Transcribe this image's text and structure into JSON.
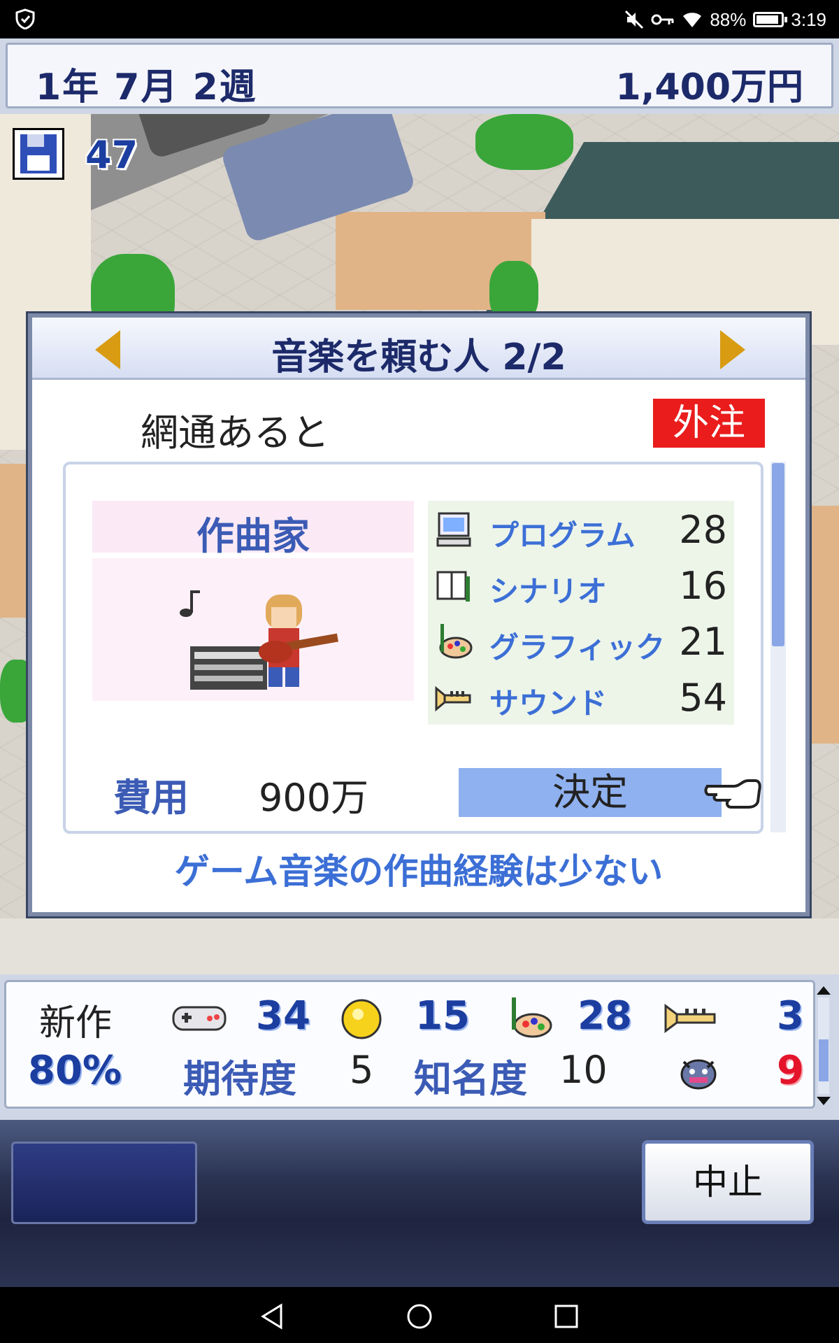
{
  "status_bar": {
    "battery": "88%",
    "battery_level": 0.88,
    "time": "3:19",
    "icons": [
      "shield-icon",
      "mute-icon",
      "key-icon",
      "wifi-icon",
      "battery-icon"
    ]
  },
  "header": {
    "date": "1年 7月 2週",
    "money": "1,400万円"
  },
  "save": {
    "count": "47",
    "icon": "floppy-disk-icon"
  },
  "dialog": {
    "title": "音楽を頼む人 2/2",
    "name": "網通あると",
    "badge": "外注",
    "role": "作曲家",
    "stats": [
      {
        "label": "プログラム",
        "value": "28",
        "icon": "computer-icon"
      },
      {
        "label": "シナリオ",
        "value": "16",
        "icon": "book-icon"
      },
      {
        "label": "グラフィック",
        "value": "21",
        "icon": "palette-icon"
      },
      {
        "label": "サウンド",
        "value": "54",
        "icon": "trumpet-icon"
      }
    ],
    "cost_label": "費用",
    "cost_value": "900万",
    "decide_label": "決定",
    "comment": "ゲーム音楽の作曲経験は少ない"
  },
  "info": {
    "new_work_label": "新作",
    "progress": "80%",
    "fun": "34",
    "coin": "15",
    "graphics": "28",
    "sound": "3",
    "bugs": "9",
    "expect_label": "期待度",
    "expect_value": "5",
    "fame_label": "知名度",
    "fame_value": "10"
  },
  "bottom": {
    "cancel_label": "中止"
  },
  "colors": {
    "badge_red": "#ea1c1c",
    "accent_blue": "#3b5bb5",
    "button_blue": "#8fb1ef",
    "arrow_gold": "#d89b12"
  }
}
